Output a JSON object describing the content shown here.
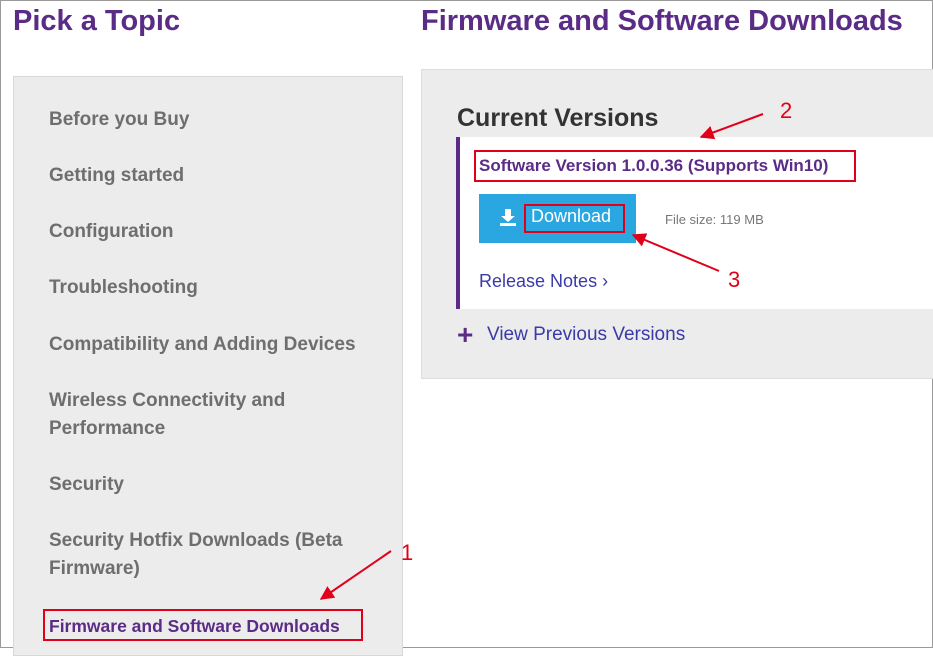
{
  "sidebar": {
    "title": "Pick a Topic",
    "items": [
      {
        "label": "Before you Buy"
      },
      {
        "label": "Getting started"
      },
      {
        "label": "Configuration"
      },
      {
        "label": "Troubleshooting"
      },
      {
        "label": "Compatibility and Adding Devices"
      },
      {
        "label": "Wireless Connectivity and Performance"
      },
      {
        "label": "Security"
      },
      {
        "label": "Security Hotfix Downloads (Beta Firmware)"
      },
      {
        "label": "Firmware and Software Downloads"
      }
    ]
  },
  "main": {
    "title": "Firmware and Software Downloads",
    "current_versions_heading": "Current Versions",
    "version_title": "Software Version 1.0.0.36 (Supports Win10)",
    "download_label": "Download",
    "file_size": "File size: 119 MB",
    "release_notes": "Release Notes ›",
    "view_previous": "View Previous Versions"
  },
  "annotations": [
    "1",
    "2",
    "3"
  ],
  "colors": {
    "brand_purple": "#5b2c86",
    "download_blue": "#2aa7e0",
    "annotation_red": "#e0001a",
    "link_blue": "#3a3aa8"
  },
  "icons": {
    "download": "download-icon",
    "plus": "plus-icon"
  }
}
